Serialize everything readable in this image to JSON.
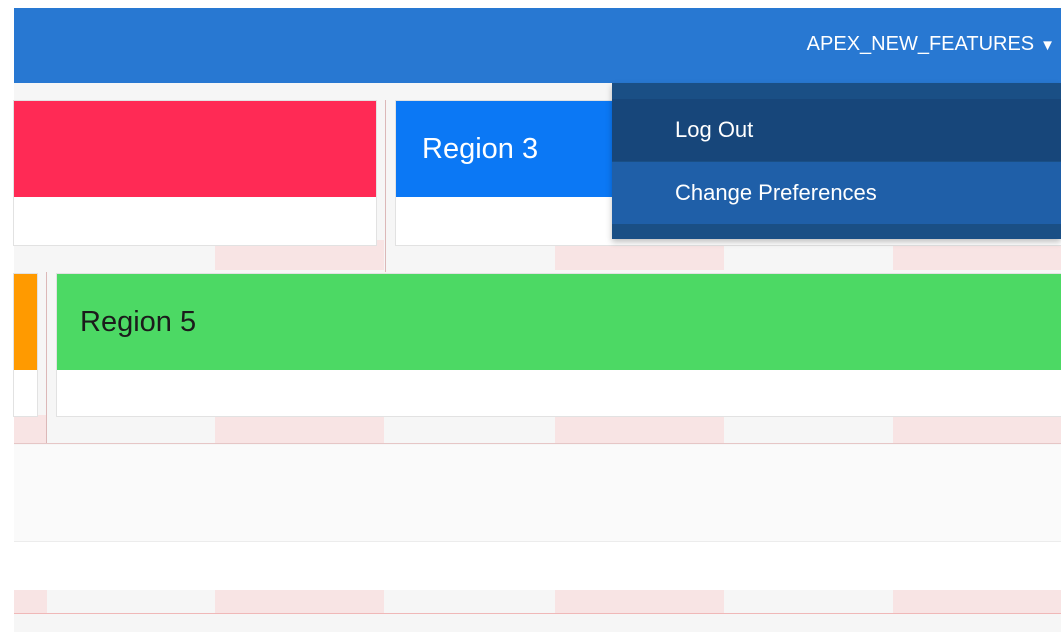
{
  "header": {
    "username": "APEX_NEW_FEATURES",
    "caret": "▼",
    "color": "#2878d2"
  },
  "regions": [
    {
      "id": "region-2",
      "title": "",
      "color": "#ff2a55"
    },
    {
      "id": "region-3",
      "title": "Region 3",
      "color": "#0b78f5"
    },
    {
      "id": "region-4",
      "title": "",
      "color": "#ff9a00"
    },
    {
      "id": "region-5",
      "title": "Region 5",
      "color": "#4cd964"
    }
  ],
  "user_dropdown": {
    "items": [
      {
        "label": "Log Out"
      },
      {
        "label": "Change Preferences"
      }
    ],
    "color": "#1a4f85"
  }
}
